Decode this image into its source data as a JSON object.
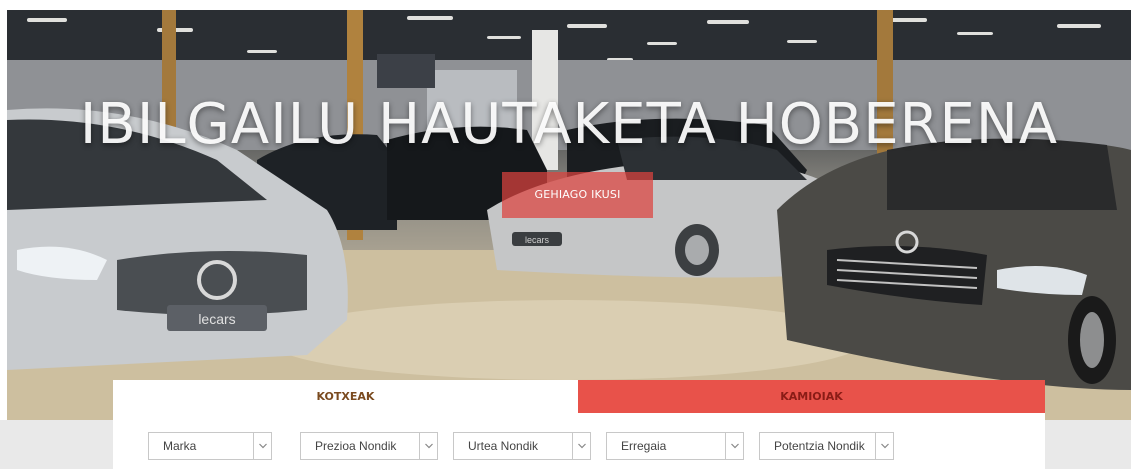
{
  "hero": {
    "title": "IBILGAILU HAUTAKETA HOBERENA",
    "cta_label": "GEHIAGO IKUSI",
    "plate_texts": [
      "lecars",
      "lecars",
      "lecars"
    ]
  },
  "tabs": [
    {
      "label": "KOTXEAK",
      "active": true
    },
    {
      "label": "KAMIOIAK",
      "active": false
    }
  ],
  "filters": [
    {
      "label": "Marka"
    },
    {
      "label": "Prezioa Nondik"
    },
    {
      "label": "Urtea Nondik"
    },
    {
      "label": "Erregaia"
    },
    {
      "label": "Potentzia Nondik"
    }
  ],
  "colors": {
    "accent_red": "#e8524a",
    "cta_red": "#dc433e",
    "tab_active_text": "#7a4a1f",
    "tab_inactive_text": "#8a1c16",
    "strip_grey": "#e9e9e9"
  }
}
